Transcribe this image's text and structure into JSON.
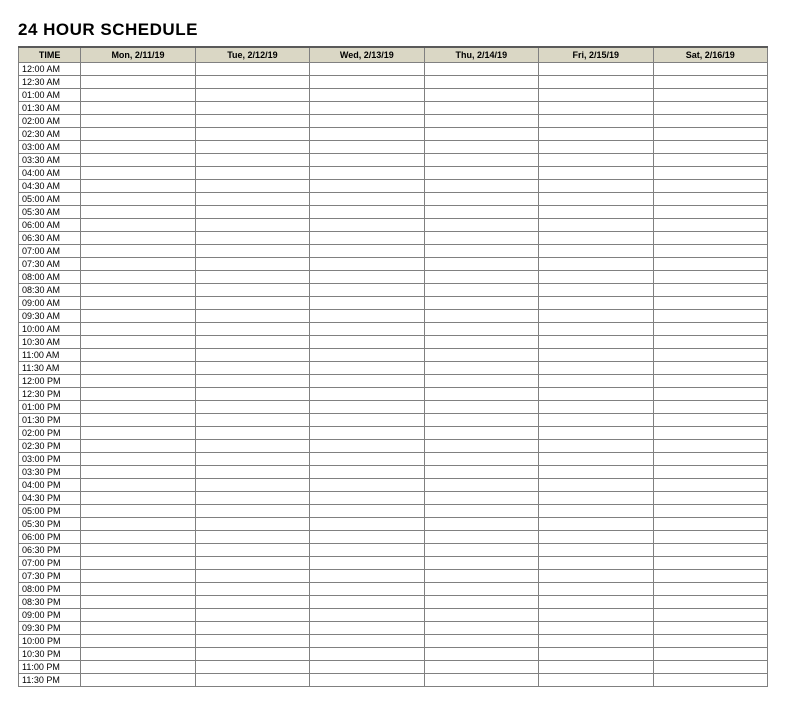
{
  "title": "24 HOUR SCHEDULE",
  "headers": {
    "time": "TIME",
    "days": [
      "Mon, 2/11/19",
      "Tue, 2/12/19",
      "Wed, 2/13/19",
      "Thu, 2/14/19",
      "Fri, 2/15/19",
      "Sat, 2/16/19"
    ]
  },
  "times": [
    "12:00 AM",
    "12:30 AM",
    "01:00 AM",
    "01:30 AM",
    "02:00 AM",
    "02:30 AM",
    "03:00 AM",
    "03:30 AM",
    "04:00 AM",
    "04:30 AM",
    "05:00 AM",
    "05:30 AM",
    "06:00 AM",
    "06:30 AM",
    "07:00 AM",
    "07:30 AM",
    "08:00 AM",
    "08:30 AM",
    "09:00 AM",
    "09:30 AM",
    "10:00 AM",
    "10:30 AM",
    "11:00 AM",
    "11:30 AM",
    "12:00 PM",
    "12:30 PM",
    "01:00 PM",
    "01:30 PM",
    "02:00 PM",
    "02:30 PM",
    "03:00 PM",
    "03:30 PM",
    "04:00 PM",
    "04:30 PM",
    "05:00 PM",
    "05:30 PM",
    "06:00 PM",
    "06:30 PM",
    "07:00 PM",
    "07:30 PM",
    "08:00 PM",
    "08:30 PM",
    "09:00 PM",
    "09:30 PM",
    "10:00 PM",
    "10:30 PM",
    "11:00 PM",
    "11:30 PM"
  ],
  "cells": {}
}
